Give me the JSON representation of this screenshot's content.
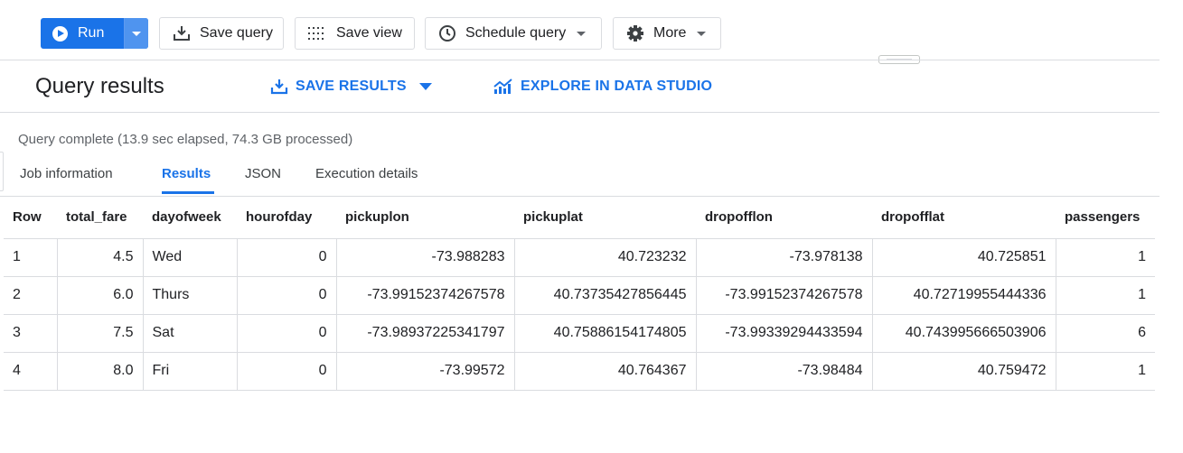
{
  "toolbar": {
    "run_label": "Run",
    "save_query_label": "Save query",
    "save_view_label": "Save view",
    "schedule_query_label": "Schedule query",
    "more_label": "More"
  },
  "results": {
    "title": "Query results",
    "save_results_label": "SAVE RESULTS",
    "explore_label": "EXPLORE IN DATA STUDIO",
    "status": "Query complete (13.9 sec elapsed, 74.3 GB processed)"
  },
  "tabs": [
    {
      "label": "Job information",
      "active": false
    },
    {
      "label": "Results",
      "active": true
    },
    {
      "label": "JSON",
      "active": false
    },
    {
      "label": "Execution details",
      "active": false
    }
  ],
  "table": {
    "columns": [
      "Row",
      "total_fare",
      "dayofweek",
      "hourofday",
      "pickuplon",
      "pickuplat",
      "dropofflon",
      "dropofflat",
      "passengers"
    ],
    "rows": [
      [
        "1",
        "4.5",
        "Wed",
        "0",
        "-73.988283",
        "40.723232",
        "-73.978138",
        "40.725851",
        "1"
      ],
      [
        "2",
        "6.0",
        "Thurs",
        "0",
        "-73.99152374267578",
        "40.73735427856445",
        "-73.99152374267578",
        "40.72719955444336",
        "1"
      ],
      [
        "3",
        "7.5",
        "Sat",
        "0",
        "-73.98937225341797",
        "40.75886154174805",
        "-73.99339294433594",
        "40.743995666503906",
        "6"
      ],
      [
        "4",
        "8.0",
        "Fri",
        "0",
        "-73.99572",
        "40.764367",
        "-73.98484",
        "40.759472",
        "1"
      ]
    ]
  },
  "colors": {
    "accent": "#1a73e8",
    "border": "#dadce0",
    "muted_text": "#5f6368"
  }
}
